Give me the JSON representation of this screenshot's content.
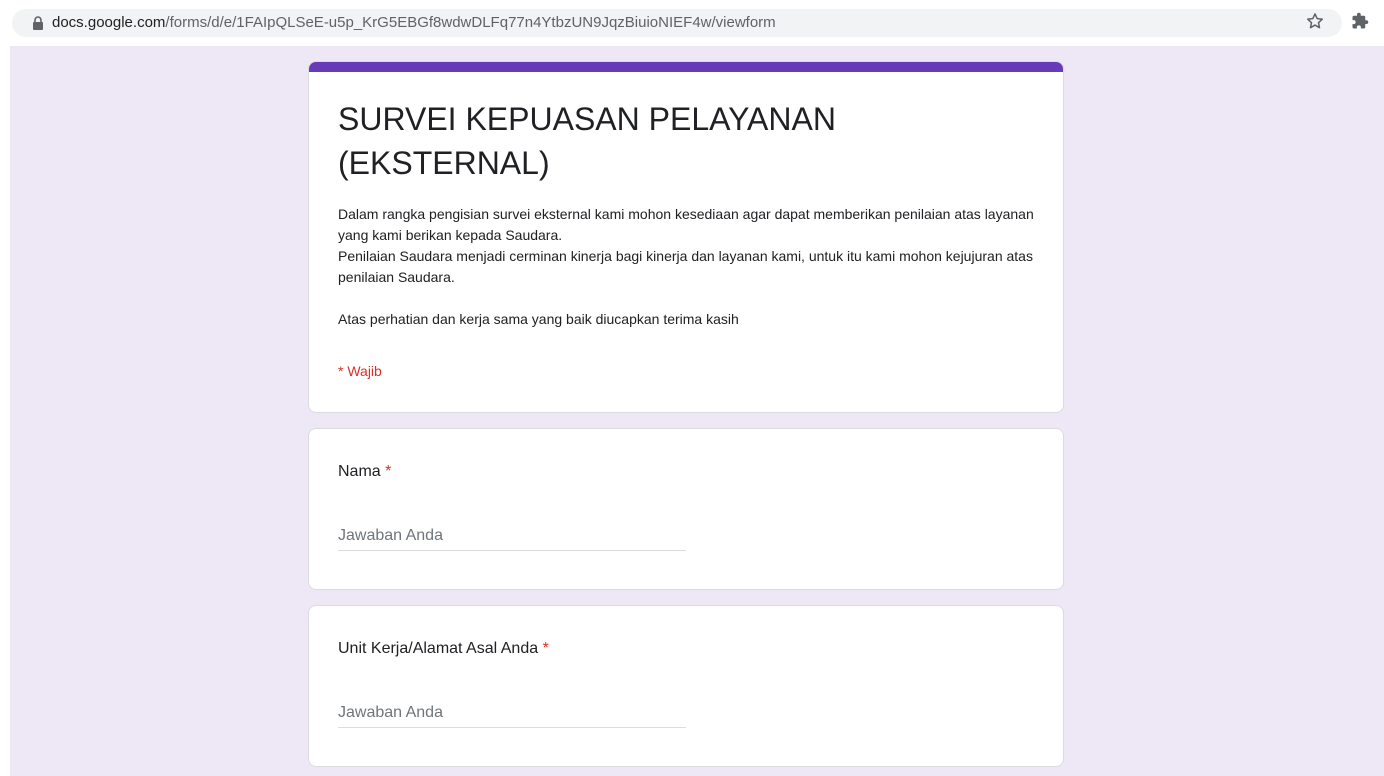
{
  "browser": {
    "url_host": "docs.google.com",
    "url_path": "/forms/d/e/1FAIpQLSeE-u5p_KrG5EBGf8wdwDLFq77n4YtbzUN9JqzBiuioNIEF4w/viewform",
    "icons": [
      "lock-icon",
      "star-icon",
      "puzzle-icon"
    ]
  },
  "form": {
    "accent_color": "#673ab7",
    "background_color": "#ede7f6",
    "title": "SURVEI KEPUASAN PELAYANAN (EKSTERNAL)",
    "description_lines": [
      "Dalam rangka pengisian survei eksternal kami mohon kesediaan agar dapat memberikan penilaian atas layanan yang kami berikan kepada Saudara.",
      "Penilaian Saudara menjadi cerminan kinerja bagi kinerja dan layanan kami, untuk itu kami mohon kejujuran atas penilaian Saudara.",
      "Atas perhatian dan kerja sama yang baik diucapkan terima kasih"
    ],
    "required_note": "* Wajib",
    "required_color": "#d93025"
  },
  "questions": [
    {
      "label": "Nama",
      "required_mark": "*",
      "placeholder": "Jawaban Anda",
      "value": ""
    },
    {
      "label": "Unit Kerja/Alamat Asal Anda",
      "required_mark": "*",
      "placeholder": "Jawaban Anda",
      "value": ""
    }
  ]
}
